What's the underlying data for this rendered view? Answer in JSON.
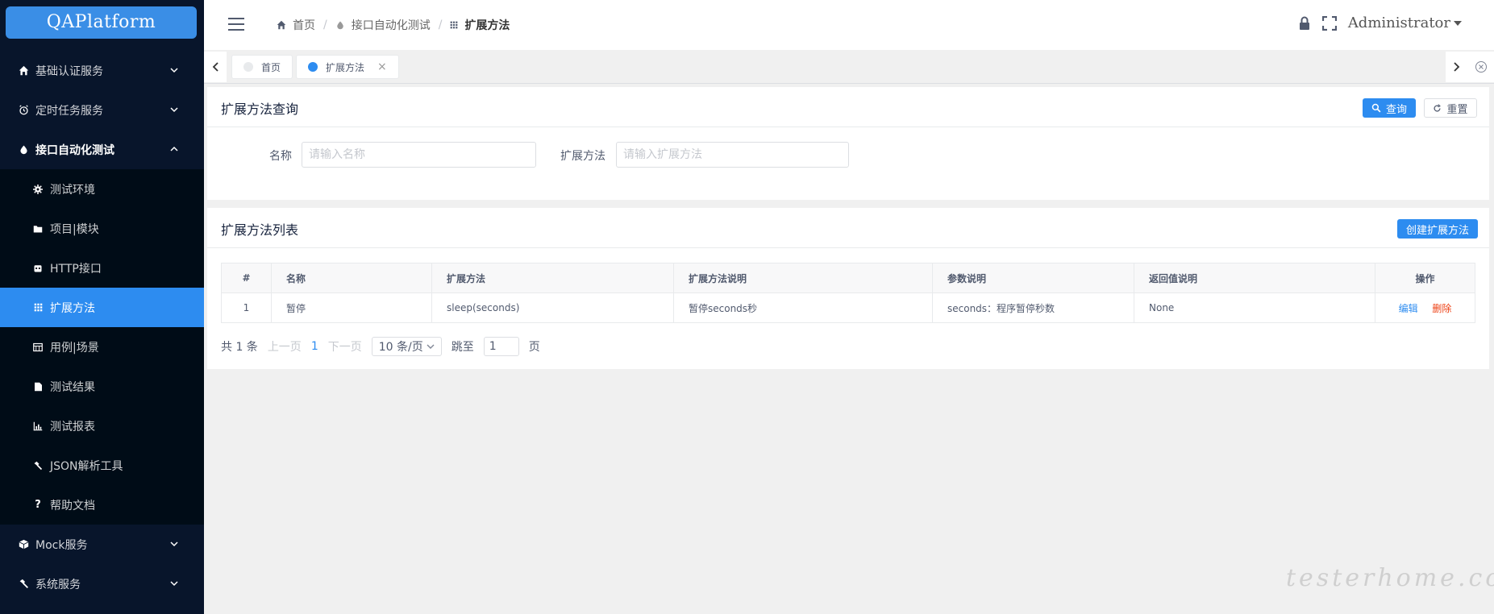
{
  "app": {
    "logo": "QAPlatform"
  },
  "sidebar": {
    "items": [
      {
        "label": "基础认证服务",
        "icon": "home-icon"
      },
      {
        "label": "定时任务服务",
        "icon": "alarm-icon"
      },
      {
        "label": "接口自动化测试",
        "icon": "drop-icon",
        "open": true
      }
    ],
    "sub": [
      {
        "label": "测试环境",
        "icon": "gear-icon"
      },
      {
        "label": "项目|模块",
        "icon": "folder-icon"
      },
      {
        "label": "HTTP接口",
        "icon": "robot-icon"
      },
      {
        "label": "扩展方法",
        "icon": "grid-icon",
        "active": true
      },
      {
        "label": "用例|场景",
        "icon": "calendar-icon"
      },
      {
        "label": "测试结果",
        "icon": "document-icon"
      },
      {
        "label": "测试报表",
        "icon": "bar-chart-icon"
      },
      {
        "label": "JSON解析工具",
        "icon": "hammer-icon"
      },
      {
        "label": "帮助文档",
        "icon": "question-icon"
      }
    ],
    "bottom": [
      {
        "label": "Mock服务",
        "icon": "cube-icon"
      },
      {
        "label": "系统服务",
        "icon": "hammer-icon"
      }
    ]
  },
  "header": {
    "breadcrumb": [
      "首页",
      "接口自动化测试",
      "扩展方法"
    ],
    "user": "Administrator"
  },
  "tags": [
    {
      "label": "首页",
      "active": false
    },
    {
      "label": "扩展方法",
      "active": true,
      "close": "×"
    }
  ],
  "query": {
    "title": "扩展方法查询",
    "search_btn": "查询",
    "reset_btn": "重置",
    "name_label": "名称",
    "name_placeholder": "请输入名称",
    "method_label": "扩展方法",
    "method_placeholder": "请输入扩展方法"
  },
  "list": {
    "title": "扩展方法列表",
    "create_btn": "创建扩展方法",
    "columns": [
      "#",
      "名称",
      "扩展方法",
      "扩展方法说明",
      "参数说明",
      "返回值说明",
      "操作"
    ],
    "rows": [
      {
        "idx": "1",
        "name": "暂停",
        "method": "sleep(seconds)",
        "desc": "暂停seconds秒",
        "params": "seconds：程序暂停秒数",
        "ret": "None",
        "edit": "编辑",
        "del": "删除"
      }
    ]
  },
  "pager": {
    "total": "共 1 条",
    "prev": "上一页",
    "page": "1",
    "next": "下一页",
    "size": "10 条/页",
    "jump_label": "跳至",
    "jump_value": "1",
    "page_suffix": "页"
  },
  "watermark": "testerhome.com",
  "colors": {
    "primary": "#2d8cf0",
    "sidebar": "#08152b",
    "danger": "#ed4014"
  }
}
